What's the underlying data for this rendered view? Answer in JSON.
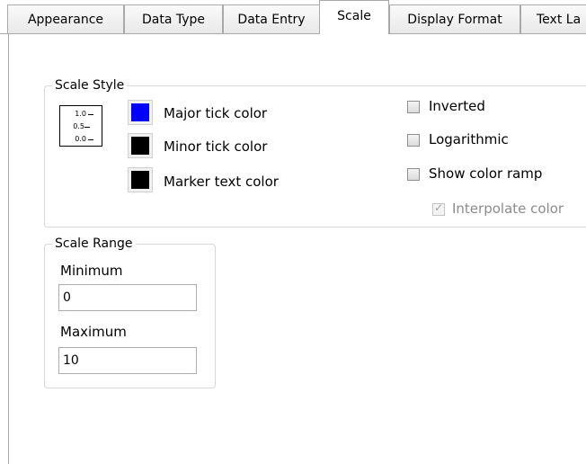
{
  "tabs": [
    {
      "label": "Appearance",
      "active": false
    },
    {
      "label": "Data Type",
      "active": false
    },
    {
      "label": "Data Entry",
      "active": false
    },
    {
      "label": "Scale",
      "active": true
    },
    {
      "label": "Display Format",
      "active": false
    },
    {
      "label": "Text La",
      "active": false
    }
  ],
  "scale_style": {
    "title": "Scale Style",
    "preview_ticks": [
      "1.0",
      "0.5",
      "0.0"
    ],
    "colors": [
      {
        "label": "Major tick color",
        "color": "#0000ff"
      },
      {
        "label": "Minor tick color",
        "color": "#000000"
      },
      {
        "label": "Marker text color",
        "color": "#000000"
      }
    ],
    "options": [
      {
        "label": "Inverted",
        "checked": false,
        "enabled": true
      },
      {
        "label": "Logarithmic",
        "checked": false,
        "enabled": true
      },
      {
        "label": "Show color ramp",
        "checked": false,
        "enabled": true
      },
      {
        "label": "Interpolate color",
        "checked": true,
        "enabled": false
      }
    ]
  },
  "scale_range": {
    "title": "Scale Range",
    "minimum_label": "Minimum",
    "minimum_value": "0",
    "maximum_label": "Maximum",
    "maximum_value": "10"
  }
}
